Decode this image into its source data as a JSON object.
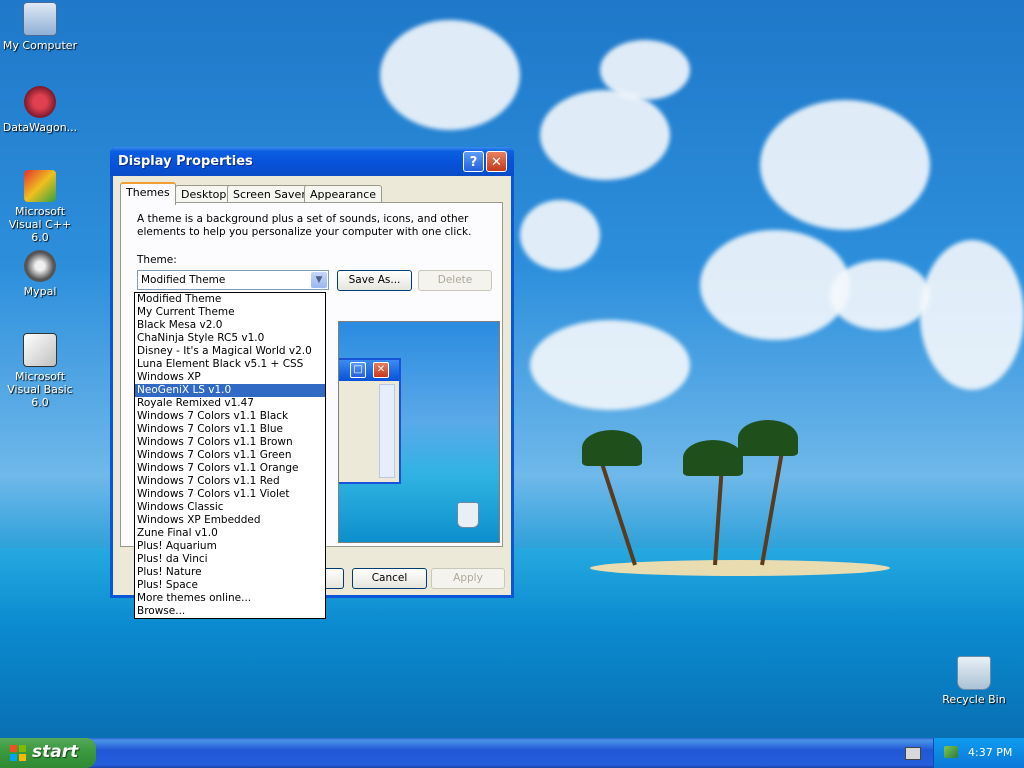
{
  "desktop": {
    "icons": [
      {
        "label": "My Computer",
        "icon": "my-computer-icon"
      },
      {
        "label": "DataWagon...",
        "icon": "datawagon-icon"
      },
      {
        "label": "Microsoft Visual C++ 6.0",
        "icon": "visual-cpp-icon"
      },
      {
        "label": "Mypal",
        "icon": "mypal-icon"
      },
      {
        "label": "Microsoft Visual Basic 6.0",
        "icon": "visual-basic-icon"
      },
      {
        "label": "Recycle Bin",
        "icon": "recycle-bin-icon"
      }
    ]
  },
  "dialog": {
    "title": "Display Properties",
    "help_label": "?",
    "close_label": "✕",
    "tabs": [
      {
        "label": "Themes"
      },
      {
        "label": "Desktop"
      },
      {
        "label": "Screen Saver"
      },
      {
        "label": "Appearance"
      }
    ],
    "description": "A theme is a background plus a set of sounds, icons, and other elements to help you personalize your computer with one click.",
    "theme_label": "Theme:",
    "theme_value": "Modified Theme",
    "save_as_label": "Save As...",
    "delete_label": "Delete",
    "cancel_label": "Cancel",
    "apply_label": "Apply"
  },
  "theme_dropdown": {
    "selected_index": 7,
    "items": [
      "Modified Theme",
      "My Current Theme",
      "Black Mesa v2.0",
      "ChaNinja Style RC5 v1.0",
      "Disney - It's a Magical World v2.0",
      "Luna Element Black v5.1 + CSS",
      "Windows XP",
      "NeoGeniX LS v1.0",
      "Royale Remixed v1.47",
      "Windows 7 Colors v1.1 Black",
      "Windows 7 Colors v1.1 Blue",
      "Windows 7 Colors v1.1 Brown",
      "Windows 7 Colors v1.1 Green",
      "Windows 7 Colors v1.1 Orange",
      "Windows 7 Colors v1.1 Red",
      "Windows 7 Colors v1.1 Violet",
      "Windows Classic",
      "Windows XP Embedded",
      "Zune Final v1.0",
      "Plus! Aquarium",
      "Plus! da Vinci",
      "Plus! Nature",
      "Plus! Space",
      "More themes online...",
      "Browse..."
    ]
  },
  "taskbar": {
    "start_label": "start",
    "clock": "4:37 PM"
  },
  "colors": {
    "selection": "#316ac5",
    "titlebar": "#0751d8",
    "start_green": "#3c9a3f"
  }
}
